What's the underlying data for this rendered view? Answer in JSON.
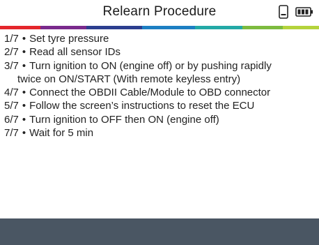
{
  "header": {
    "title": "Relearn Procedure"
  },
  "icons": {
    "device": "phone-device-icon",
    "battery": "battery-icon"
  },
  "stripe_colors": [
    "#e4262c",
    "#7a2a8c",
    "#2c3e8f",
    "#1d7fc3",
    "#23a9a6",
    "#7dbb3f",
    "#b4d33c"
  ],
  "steps": [
    {
      "num": "1/7",
      "text": "Set tyre pressure"
    },
    {
      "num": "2/7",
      "text": "Read all sensor IDs"
    },
    {
      "num": "3/7",
      "text": "Turn ignition to ON (engine off) or by pushing rapidly",
      "text2": "twice on ON/START (With remote keyless entry)"
    },
    {
      "num": "4/7",
      "text": "Connect the OBDII Cable/Module to OBD connector"
    },
    {
      "num": "5/7",
      "text": "Follow the screen’s instructions to reset the ECU"
    },
    {
      "num": "6/7",
      "text": "Turn ignition to OFF then ON (engine off)"
    },
    {
      "num": "7/7",
      "text": "Wait for 5 min"
    }
  ]
}
